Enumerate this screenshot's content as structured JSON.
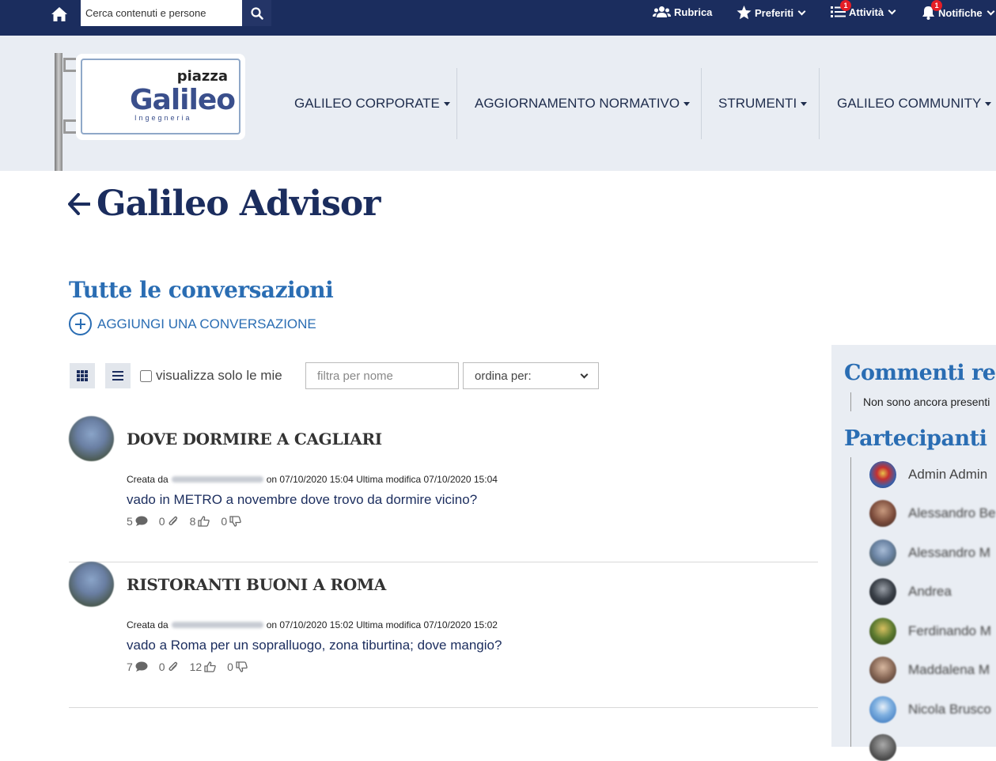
{
  "topbar": {
    "search_placeholder": "Cerca contenuti e persone",
    "rubrica": "Rubrica",
    "preferiti": "Preferiti",
    "attivita": "Attività",
    "attivita_badge": "1",
    "notifiche": "Notifiche",
    "notifiche_badge": "1"
  },
  "logo": {
    "piazza": "piazza",
    "galileo": "Galileo",
    "ingegneria": "Ingegneria"
  },
  "nav": {
    "items": [
      {
        "label": "GALILEO CORPORATE"
      },
      {
        "label": "AGGIORNAMENTO NORMATIVO"
      },
      {
        "label": "STRUMENTI"
      },
      {
        "label": "GALILEO COMMUNITY"
      }
    ]
  },
  "page": {
    "title": "Galileo Advisor",
    "section_title": "Tutte le conversazioni",
    "add_conversation": "AGGIUNGI UNA CONVERSAZIONE"
  },
  "toolbar": {
    "only_mine_label": "visualizza solo le mie",
    "filter_placeholder": "filtra per nome",
    "sort_label": "ordina per:"
  },
  "conversations": [
    {
      "title": "DOVE DORMIRE A CAGLIARI",
      "created_prefix": "Creata da",
      "created_on": "on 07/10/2020 15:04 Ultima modifica 07/10/2020 15:04",
      "text": "vado in METRO a novembre dove trovo da dormire vicino?",
      "comments": "5",
      "attachments": "0",
      "likes": "8",
      "dislikes": "0"
    },
    {
      "title": "RISTORANTI BUONI A ROMA",
      "created_prefix": "Creata da",
      "created_on": "on 07/10/2020 15:02 Ultima modifica 07/10/2020 15:02",
      "text": "vado a Roma per un sopralluogo, zona tiburtina; dove mangio?",
      "comments": "7",
      "attachments": "0",
      "likes": "12",
      "dislikes": "0"
    }
  ],
  "sidebar": {
    "comments_title": "Commenti rece",
    "no_comments": "Non sono ancora presenti",
    "participants_title": "Partecipanti",
    "participants": [
      {
        "name": "Admin Admin",
        "color": "#3b5fa8"
      },
      {
        "name": "Alessandro Be",
        "color": "#7a4a3a"
      },
      {
        "name": "Alessandro M",
        "color": "#6b84a4"
      },
      {
        "name": "Andrea",
        "color": "#3a4048"
      },
      {
        "name": "Ferdinando M",
        "color": "#5c7a2f"
      },
      {
        "name": "Maddalena M",
        "color": "#8a6a58"
      },
      {
        "name": "Nicola Brusco",
        "color": "#2f6db8"
      }
    ]
  }
}
